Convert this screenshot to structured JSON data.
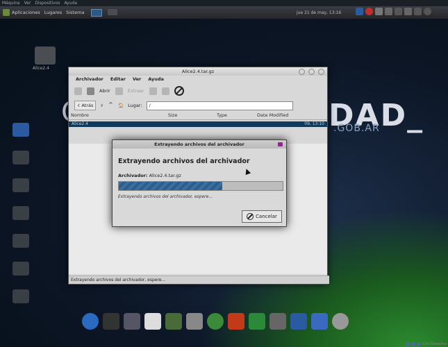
{
  "vm_menu": [
    "Máquina",
    "Ver",
    "Dispositivos",
    "Ayuda"
  ],
  "panel": {
    "menus": [
      "Aplicaciones",
      "Lugares",
      "Sistema"
    ],
    "clock": "jue 21 de may, 13:16"
  },
  "desktop": {
    "brand": "DAD_",
    "brand_sub": ".GOB.AR",
    "brand_c": "C",
    "icon_label": "Alice2.4"
  },
  "window": {
    "title": "Alice2.4.tar.gz",
    "menu": [
      "Archivador",
      "Editar",
      "Ver",
      "Ayuda"
    ],
    "toolbar": {
      "open": "Abrir",
      "extract": "Extraer"
    },
    "location": {
      "back": "Atrás",
      "label": "Lugar:",
      "value": "/"
    },
    "columns": [
      "Nombre",
      "Size",
      "Type",
      "Date Modified"
    ],
    "file": {
      "name": "Alice2.4",
      "date": "09, 13:10"
    },
    "status": "Extrayendo archivos del archivador, espere..."
  },
  "dialog": {
    "title": "Extrayendo archivos del archivador",
    "heading": "Extrayendo archivos del archivador",
    "archive_label": "Archivador:",
    "archive_value": "Alice2.4.tar.gz",
    "progress": 0.63,
    "status": "Extrayendo archivos del archivador, espere...",
    "cancel": "Cancelar"
  },
  "tray_bottom": "Ctrl Derecho"
}
